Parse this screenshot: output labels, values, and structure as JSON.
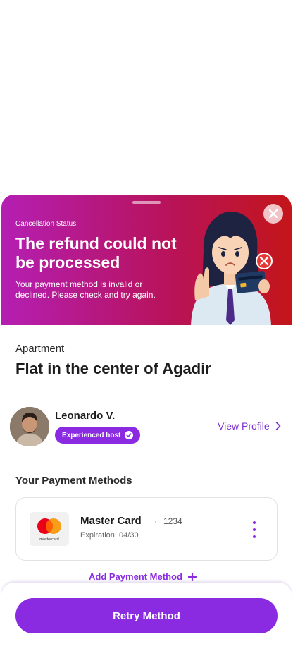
{
  "banner": {
    "status_label": "Cancellation Status",
    "title": "The refund could not be processed",
    "description": "Your payment method is invalid or declined. Please check and try again."
  },
  "listing": {
    "type": "Apartment",
    "title": "Flat in the center of Agadir"
  },
  "host": {
    "name": "Leonardo V.",
    "badge": "Experienced host",
    "view_profile": "View Profile"
  },
  "payment": {
    "heading": "Your Payment Methods",
    "card": {
      "name": "Master Card",
      "separator": "·",
      "last4": "1234",
      "expiration_label": "Expiration:",
      "expiration": "04/30",
      "brand_text": "mastercard"
    },
    "add_label": "Add Payment Method"
  },
  "footer": {
    "retry_label": "Retry Method"
  },
  "colors": {
    "accent": "#8a2be2",
    "banner_start": "#b41fb3",
    "banner_end": "#c3151a",
    "error": "#e53935"
  }
}
